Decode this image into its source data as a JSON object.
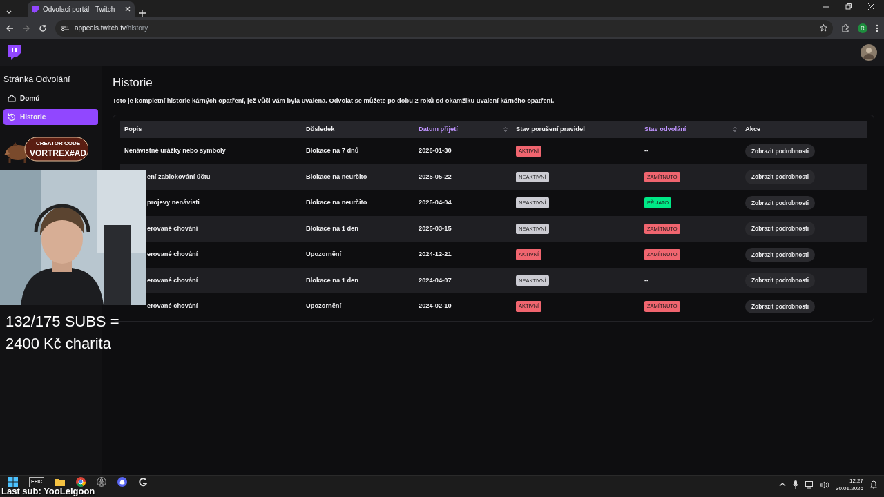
{
  "browser": {
    "tab_title": "Odvolací portál - Twitch",
    "url_host": "appeals.twitch.tv",
    "url_path": "/history",
    "profile_initial": "R"
  },
  "sidebar": {
    "title": "Stránka Odvolání",
    "items": [
      {
        "label": "Domů",
        "selected": false
      },
      {
        "label": "Historie",
        "selected": true
      }
    ]
  },
  "banner": {
    "line1": "CREATOR CODE",
    "line2": "VORTREX#AD"
  },
  "page": {
    "title": "Historie",
    "description": "Toto je kompletní historie kárných opatření, jež vůči vám byla uvalena. Odvolat se můžete po dobu 2 roků od okamžiku uvalení kárného opatření."
  },
  "table": {
    "columns": [
      {
        "label": "Popis",
        "sortable": false
      },
      {
        "label": "Důsledek",
        "sortable": false
      },
      {
        "label": "Datum přijetí",
        "sortable": true
      },
      {
        "label": "Stav porušení pravidel",
        "sortable": false
      },
      {
        "label": "Stav odvolání",
        "sortable": true
      },
      {
        "label": "Akce",
        "sortable": false
      }
    ],
    "rows": [
      {
        "popis": "Nenávistné urážky nebo symboly",
        "dusledek": "Blokace na 7 dnů",
        "datum": "2026-01-30",
        "stav": {
          "label": "AKTIVNÍ",
          "kind": "active"
        },
        "odvolani": {
          "label": "--",
          "kind": "none"
        },
        "action": "Zobrazit podrobnosti"
      },
      {
        "popis": "ení zablokování účtu",
        "dusledek": "Blokace na neurčito",
        "datum": "2025-05-22",
        "stav": {
          "label": "NEAKTIVNÍ",
          "kind": "inactive"
        },
        "odvolani": {
          "label": "ZAMÍTNUTO",
          "kind": "rejected"
        },
        "action": "Zobrazit podrobnosti"
      },
      {
        "popis": "projevy nenávisti",
        "dusledek": "Blokace na neurčito",
        "datum": "2025-04-04",
        "stav": {
          "label": "NEAKTIVNÍ",
          "kind": "inactive"
        },
        "odvolani": {
          "label": "PŘIJATO",
          "kind": "accepted"
        },
        "action": "Zobrazit podrobnosti"
      },
      {
        "popis": "erované chování",
        "dusledek": "Blokace na 1 den",
        "datum": "2025-03-15",
        "stav": {
          "label": "NEAKTIVNÍ",
          "kind": "inactive"
        },
        "odvolani": {
          "label": "ZAMÍTNUTO",
          "kind": "rejected"
        },
        "action": "Zobrazit podrobnosti"
      },
      {
        "popis": "erované chování",
        "dusledek": "Upozornění",
        "datum": "2024-12-21",
        "stav": {
          "label": "AKTIVNÍ",
          "kind": "active"
        },
        "odvolani": {
          "label": "ZAMÍTNUTO",
          "kind": "rejected"
        },
        "action": "Zobrazit podrobnosti"
      },
      {
        "popis": "erované chování",
        "dusledek": "Blokace na 1 den",
        "datum": "2024-04-07",
        "stav": {
          "label": "NEAKTIVNÍ",
          "kind": "inactive"
        },
        "odvolani": {
          "label": "--",
          "kind": "none"
        },
        "action": "Zobrazit podrobnosti"
      },
      {
        "popis": "erované chování",
        "dusledek": "Upozornění",
        "datum": "2024-02-10",
        "stav": {
          "label": "AKTIVNÍ",
          "kind": "active"
        },
        "odvolani": {
          "label": "ZAMÍTNUTO",
          "kind": "rejected"
        },
        "action": "Zobrazit podrobnosti"
      }
    ]
  },
  "overlay": {
    "subs_line1": "132/175 SUBS =",
    "subs_line2": "2400 Kč charita",
    "last_sub": "Last sub: YooLeigoon"
  },
  "taskbar": {
    "epic_label": "EPIC",
    "time": "12:27",
    "date": "30.01.2026"
  }
}
